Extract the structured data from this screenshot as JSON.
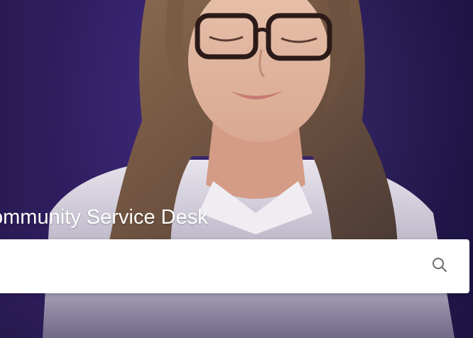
{
  "hero": {
    "background_color": "#2a1b55",
    "image_subject": "woman-with-glasses-looking-down"
  },
  "heading": {
    "text": "ommunity Service Desk"
  },
  "search": {
    "placeholder": "",
    "value": "",
    "icon": "search-icon",
    "icon_color": "#6b6b6b"
  }
}
